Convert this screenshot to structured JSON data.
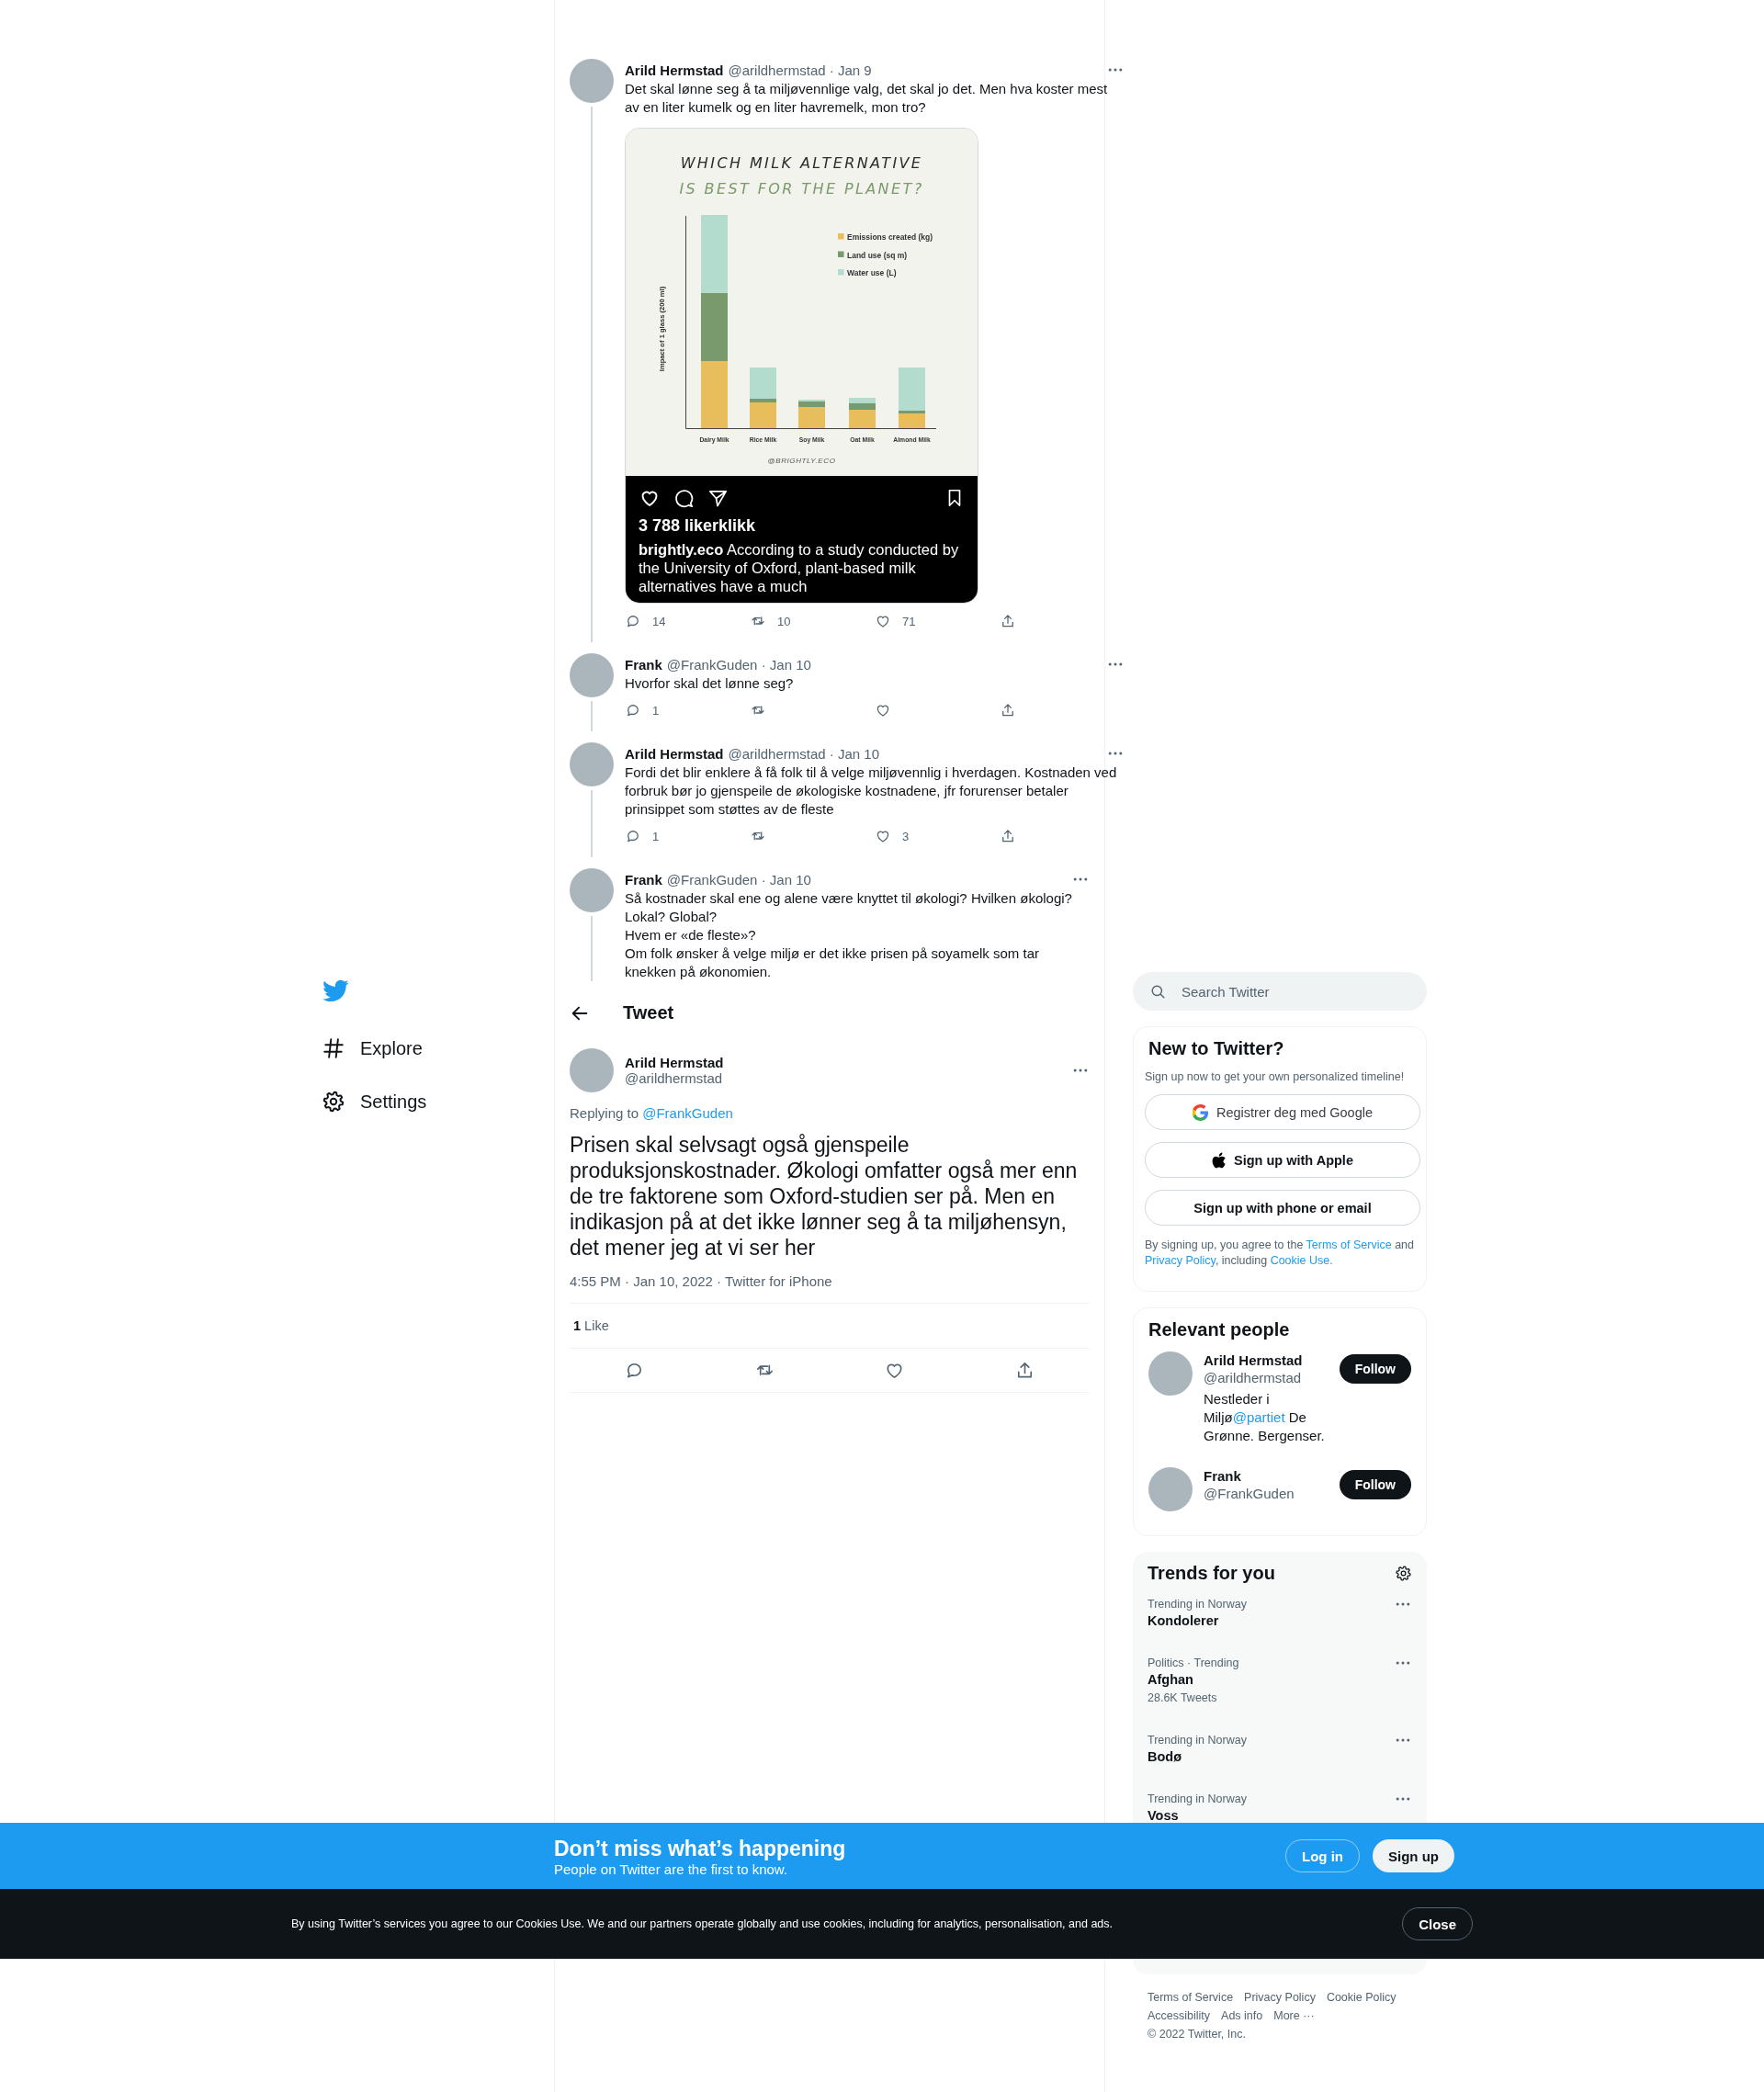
{
  "nav": {
    "items": [
      {
        "kind": "hash",
        "label": "Explore"
      },
      {
        "kind": "gear",
        "label": "Settings"
      }
    ]
  },
  "thread": [
    {
      "author": "Arild Hermstad",
      "byline": "@arildhermstad · Jan 9",
      "text": "Det skal lønne seg å ta miljøvennlige valg, det skal jo det. Men hva koster mest av en liter kumelk og en liter havremelk, mon tro?",
      "media": {
        "title": [
          "WHICH MILK ALTERNATIVE",
          "IS BEST FOR THE PLANET?"
        ],
        "ylabel": "Impact of 1 glass (200 ml)",
        "legend": [
          {
            "label": "Emissions created (kg)",
            "color": "#e8be5c"
          },
          {
            "label": "Land use (sq m)",
            "color": "#789a6c"
          },
          {
            "label": "Water use (L)",
            "color": "#b3dccf"
          }
        ],
        "categories": [
          "Dairy Milk",
          "Rice Milk",
          "Soy Milk",
          "Oat Milk",
          "Almond Milk"
        ],
        "credit": "@BRIGHTLY.ECO",
        "likes": "3 788 likerklikk",
        "caption": "**brightly.eco** According to a study conducted by the University of Oxford, plant-based milk alternatives have a much"
      },
      "actions": [
        {
          "kind": "reply",
          "count": "14"
        },
        {
          "kind": "retweet",
          "count": "10"
        },
        {
          "kind": "like",
          "count": "71"
        },
        {
          "kind": "share"
        }
      ]
    },
    {
      "author": "Frank",
      "byline": "@FrankGuden · Jan 10",
      "text": "Hvorfor skal det lønne seg?",
      "actions": [
        {
          "kind": "reply",
          "count": "1"
        },
        {
          "kind": "retweet"
        },
        {
          "kind": "like"
        },
        {
          "kind": "share"
        }
      ]
    },
    {
      "author": "Arild Hermstad",
      "byline": "@arildhermstad · Jan 10",
      "text": "Fordi det blir enklere å få folk til å velge miljøvennlig i hverdagen. Kostnaden ved forbruk bør jo gjenspeile de økologiske kostnadene, jfr forurenser betaler prinsippet som støttes av de fleste",
      "actions": [
        {
          "kind": "reply",
          "count": "1"
        },
        {
          "kind": "retweet"
        },
        {
          "kind": "like",
          "count": "3"
        },
        {
          "kind": "share"
        }
      ]
    },
    {
      "author": "Frank",
      "byline": "@FrankGuden · Jan 10",
      "text": "Så kostnader skal ene og alene være knyttet til økologi? Hvilken økologi?\nLokal? Global?\nHvem er «de fleste»?\nOm folk ønsker å velge miljø er det ikke prisen på soyamelk som tar knekken på økonomien."
    }
  ],
  "header": {
    "title": "Tweet"
  },
  "focus": {
    "author": "Arild Hermstad",
    "handle": "@arildhermstad",
    "replying_label": "Replying to",
    "replying_to": "@FrankGuden",
    "text": "Prisen skal selvsagt også gjenspeile produksjonskostnader. Økologi omfatter også mer enn de tre faktorene som Oxford-studien ser på. Men en indikasjon på at det ikke lønner seg å ta miljøhensyn, det mener jeg at vi ser her",
    "meta": "4:55 PM · Jan 10, 2022 · Twitter for iPhone",
    "likes": "**1** Like",
    "actions": [
      {
        "kind": "reply"
      },
      {
        "kind": "retweet"
      },
      {
        "kind": "like"
      },
      {
        "kind": "share"
      }
    ]
  },
  "search": {
    "placeholder": "Search Twitter"
  },
  "signup": {
    "title": "New to Twitter?",
    "subtitle": "Sign up now to get your own personalized timeline!",
    "buttons": [
      {
        "kind": "google",
        "label": "Registrer deg med Google"
      },
      {
        "kind": "apple",
        "label": "Sign up with Apple"
      },
      {
        "kind": "plain",
        "label": "Sign up with phone or email"
      }
    ],
    "terms": [
      {
        "text": "By signing up, you agree to the "
      },
      {
        "text": "Terms of Service",
        "link": true
      },
      {
        "text": " and "
      },
      {
        "text": "Privacy Policy",
        "link": true
      },
      {
        "text": ", including "
      },
      {
        "text": "Cookie Use.",
        "link": true
      }
    ]
  },
  "relevant": {
    "title": "Relevant people",
    "people": [
      {
        "name": "Arild Hermstad",
        "handle": "@arildhermstad",
        "bio": [
          {
            "text": "Nestleder i Miljø"
          },
          {
            "text": "@partiet",
            "link": true
          },
          {
            "text": " De Grønne. Bergenser."
          }
        ],
        "follow": "Follow"
      },
      {
        "name": "Frank",
        "handle": "@FrankGuden",
        "follow": "Follow"
      }
    ]
  },
  "trends": {
    "title": "Trends for you",
    "items": [
      {
        "context": "Trending in Norway",
        "name": "Kondolerer"
      },
      {
        "context": "Politics · Trending",
        "name": "Afghan",
        "count": "28.6K Tweets"
      },
      {
        "context": "Trending in Norway",
        "name": "Bodø"
      },
      {
        "context": "Trending in Norway",
        "name": "Voss"
      }
    ]
  },
  "footer": {
    "links": [
      "Terms of Service",
      "Privacy Policy",
      "Cookie Policy",
      "Accessibility",
      "Ads info",
      "More ···"
    ],
    "copyright": "© 2022 Twitter, Inc."
  },
  "banner": {
    "title": "Don’t miss what’s happening",
    "subtitle": "People on Twitter are the first to know.",
    "login": "Log in",
    "signup": "Sign up"
  },
  "cookie": {
    "text": "By using Twitter’s services you agree to our Cookies Use. We and our partners operate globally and use cookies, including for analytics, personalisation, and ads.",
    "close": "Close"
  }
}
